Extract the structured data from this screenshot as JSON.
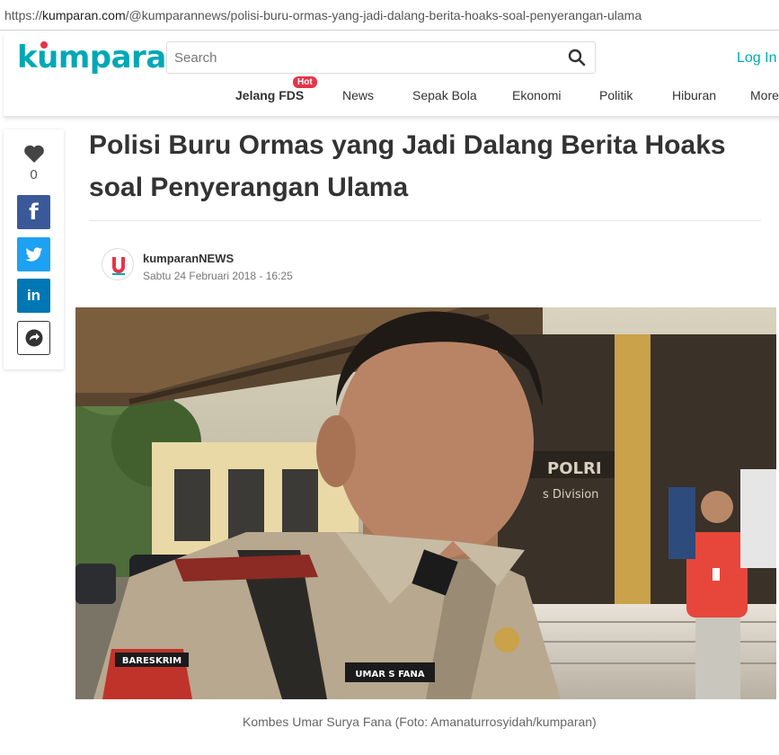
{
  "browser": {
    "url_prefix": "https://",
    "url_domain": "kumparan.com",
    "url_path": "/@kumparannews/polisi-buru-ormas-yang-jadi-dalang-berita-hoaks-soal-penyerangan-ulama"
  },
  "header": {
    "logo_text_pre": "k",
    "logo_text_u": "u",
    "logo_text_post": "mparan",
    "search_placeholder": "Search",
    "login_label": "Log In /",
    "nav": [
      {
        "label": "Jelang FDS",
        "badge": "Hot"
      },
      {
        "label": "News"
      },
      {
        "label": "Sepak Bola"
      },
      {
        "label": "Ekonomi"
      },
      {
        "label": "Politik"
      },
      {
        "label": "Hiburan"
      },
      {
        "label": "More"
      }
    ]
  },
  "share": {
    "like_count": "0",
    "facebook_glyph": "f",
    "linkedin_glyph": "in"
  },
  "article": {
    "title": "Polisi Buru Ormas yang Jadi Dalang Berita Hoaks soal Penyerangan Ulama",
    "author": "kumparanNEWS",
    "date": "Sabtu 24 Februari 2018 - 16:25",
    "photo_texts": {
      "name_tag": "UMAR S FANA",
      "unit_patch": "BARESKRIM",
      "building_sign_1": "POLRI",
      "building_sign_2": "s Division"
    },
    "caption": "Kombes Umar Surya Fana (Foto: Amanaturrosyidah/kumparan)"
  },
  "colors": {
    "brand": "#00a8b5",
    "hot_badge": "#e8334a",
    "facebook": "#3b5998",
    "twitter": "#1da1f2",
    "linkedin": "#0077b5"
  }
}
